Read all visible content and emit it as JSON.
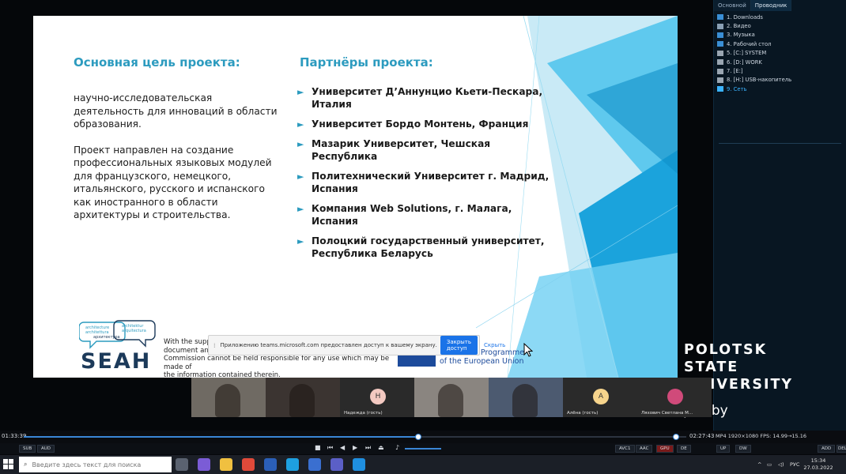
{
  "slide": {
    "left_title": "Основная цель проекта:",
    "left_para1": "научно-исследовательская деятельность для инноваций в области образования.",
    "left_para2": "Проект направлен на создание профессиональных языковых модулей для французского, немецкого, итальянского, русского и испанского как иностранного в области архитектуры и строительства.",
    "right_title": "Партнёры проекта:",
    "bullet_glyph": "►",
    "partners": [
      "Университет Д’Аннунцио Кьети-Пескара, Италия",
      "Университет Бордо Монтень, Франция",
      "Мазарик Университет, Чешская Республика",
      "Политехнический Университет г. Мадрид, Испания",
      "Компания Web Solutions, г. Малага, Испания",
      "Полоцкий государственный университет, Республика Беларусь"
    ],
    "logo": {
      "text": "SEAH",
      "cloud_words": [
        "architecture",
        "architettura",
        "архитектура",
        "architektur",
        "arquitectura"
      ]
    },
    "support_text_lines": [
      "With the suppo",
      "document and",
      "Commission cannot be held responsible for any use which may be made of",
      "the information contained therein."
    ],
    "eu_text_lines": [
      "Erasmus+ Programme",
      "of the European Union"
    ],
    "accent_color": "#2c9bbf"
  },
  "share_bar": {
    "message": "Приложению teams.microsoft.com предоставлен доступ к вашему экрану.",
    "stop_button": "Закрыть доступ",
    "hide_link": "Скрыть"
  },
  "explorer": {
    "tabs": [
      "Основной",
      "Проводник"
    ],
    "items": [
      {
        "label": "1. Downloads",
        "icon": "download-icon",
        "color": "#3a8fd6"
      },
      {
        "label": "2. Видео",
        "icon": "video-icon",
        "color": "#8aa0b5"
      },
      {
        "label": "3. Музыка",
        "icon": "music-icon",
        "color": "#3a8fd6"
      },
      {
        "label": "4. Рабочий стол",
        "icon": "desktop-icon",
        "color": "#3a8fd6"
      },
      {
        "label": "5. [C:] SYSTEM",
        "icon": "drive-icon",
        "color": "#9aa6b2"
      },
      {
        "label": "6. [D:] WORK",
        "icon": "drive-icon",
        "color": "#9aa6b2"
      },
      {
        "label": "7. [E:]",
        "icon": "drive-icon",
        "color": "#9aa6b2"
      },
      {
        "label": "8. [H:] USB-накопитель",
        "icon": "usb-drive-icon",
        "color": "#9aa6b2"
      },
      {
        "label": "9. Сеть",
        "icon": "network-icon",
        "color": "#3ab3ff"
      }
    ],
    "active_index": 8
  },
  "watermark": {
    "lines": [
      "POLOTSK",
      "STATE",
      "UNIVERSITY"
    ],
    "url": "psu.by"
  },
  "participants": [
    {
      "label": "",
      "type": "video",
      "bg": "#6f6a63"
    },
    {
      "label": "",
      "type": "video",
      "bg": "#3b3431"
    },
    {
      "label": "Надежда (гость)",
      "type": "avatar",
      "initial": "Н",
      "avatar_color": "#f3c9c1",
      "bg": "#2a2a2a"
    },
    {
      "label": "",
      "type": "video",
      "bg": "#8a8580"
    },
    {
      "label": "",
      "type": "video",
      "bg": "#4c5a70"
    },
    {
      "label": "Алёна (гость)",
      "type": "avatar",
      "initial": "А",
      "avatar_color": "#f6d48c",
      "bg": "#2a2a2a"
    },
    {
      "label": "Ляхович Светлана М...",
      "type": "avatar-photo",
      "initial": "",
      "avatar_color": "#d04a7a",
      "bg": "#2a2a2a"
    }
  ],
  "player": {
    "time_elapsed": "01:33:39",
    "time_remaining": "02:27:43",
    "progress": 0.595,
    "secondary_progress": 0.985,
    "media_info": "MP4  1920×1080  FPS: 14.99→15.16",
    "left_buttons": [
      "SUB",
      "AUD"
    ],
    "right_buttons": [
      "AVC1",
      "AAC",
      "GPU",
      "DE",
      "UP",
      "DW",
      "ADD",
      "DEL"
    ]
  },
  "taskbar": {
    "search_placeholder": "Введите здесь текст для поиска",
    "apps": [
      {
        "icon": "task-view-icon",
        "color": "#5a6270"
      },
      {
        "icon": "viber-icon",
        "color": "#7b5cd6"
      },
      {
        "icon": "file-explorer-icon",
        "color": "#f0c040"
      },
      {
        "icon": "chrome-icon",
        "color": "#e04a3a"
      },
      {
        "icon": "word-icon",
        "color": "#2b5fb8"
      },
      {
        "icon": "skype-icon",
        "color": "#1ea0e0"
      },
      {
        "icon": "save-app-icon",
        "color": "#3a6fd0"
      },
      {
        "icon": "teams-icon",
        "color": "#5b5fc7"
      },
      {
        "icon": "media-player-icon",
        "color": "#1f8fe0"
      }
    ],
    "lang": "РУС",
    "time": "15:34",
    "date": "27.03.2022"
  }
}
